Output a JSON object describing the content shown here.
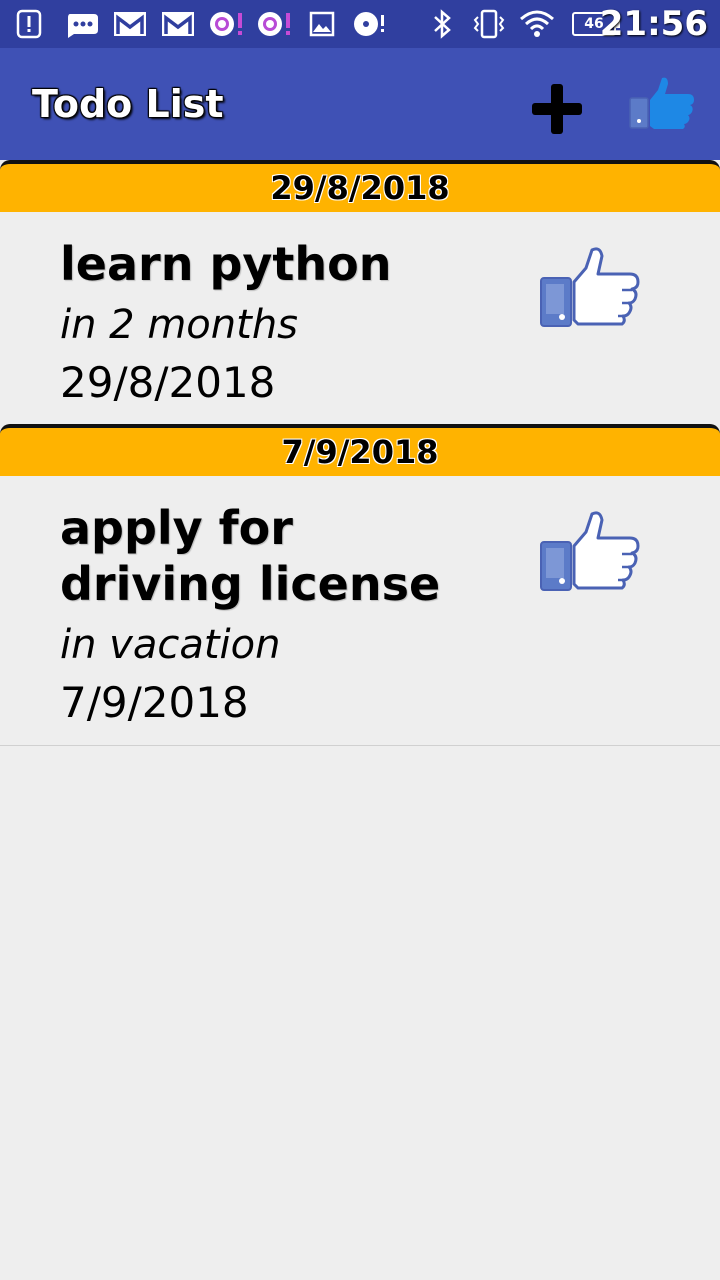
{
  "status_bar": {
    "time": "21:56",
    "battery_level": "46",
    "icons": [
      "alert-icon",
      "message-icon",
      "gmail-icon",
      "gmail-icon",
      "quora-icon",
      "quora-icon",
      "image-icon",
      "disc-icon",
      "bluetooth-icon",
      "vibrate-icon",
      "wifi-icon",
      "battery-icon"
    ]
  },
  "app_bar": {
    "title": "Todo List",
    "add_icon": "plus-icon",
    "like_icon": "thumbs-up-icon"
  },
  "sections": [
    {
      "header": "29/8/2018",
      "item": {
        "title": "learn python",
        "note": "in 2 months",
        "date": "29/8/2018",
        "icon": "thumbs-up-icon"
      }
    },
    {
      "header": "7/9/2018",
      "item": {
        "title": "apply for driving license",
        "note": "in vacation",
        "date": "7/9/2018",
        "icon": "thumbs-up-icon"
      }
    }
  ],
  "colors": {
    "status_bar": "#303f9f",
    "app_bar": "#3f51b5",
    "section_header": "#ffb300",
    "background": "#eeeeee",
    "like_blue": "#1e88e5",
    "like_outline": "#4a62b4"
  }
}
